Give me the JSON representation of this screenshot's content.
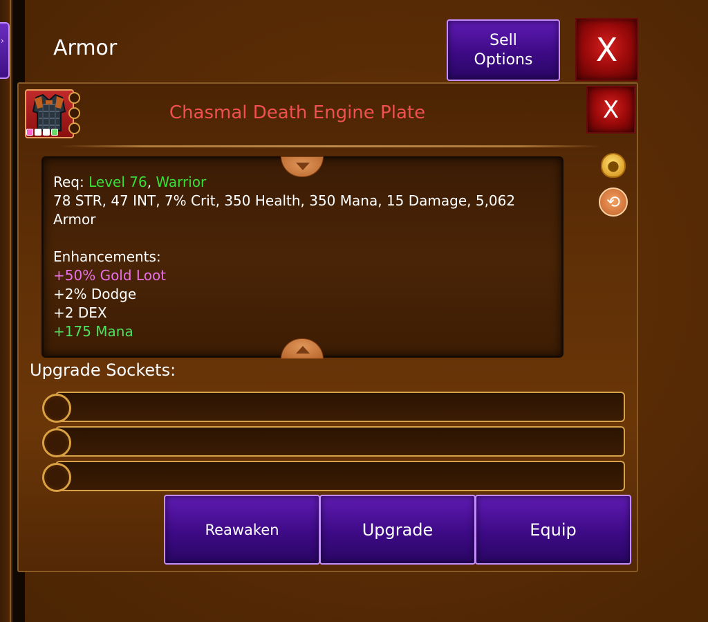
{
  "header": {
    "title": "Armor",
    "sell_button_label": "Sell Options",
    "close_label": "X"
  },
  "item": {
    "name": "Chasmal Death Engine Plate",
    "name_color": "#f05050",
    "close_label": "X",
    "rarity_pips": [
      "#ff66cc",
      "#ffffff",
      "#ffffff",
      "#66dd66"
    ],
    "requirements": {
      "prefix": "Req: ",
      "level": "Level 76",
      "separator": ", ",
      "class": "Warrior"
    },
    "stats_line1": "78 STR, 47 INT, 7% Crit, 350 Health, 350 Mana, 15 Damage, 5,062",
    "stats_line2": "Armor",
    "enhancements_title": "Enhancements:",
    "enhancements": [
      {
        "text": "+50% Gold Loot",
        "color": "#e870e8"
      },
      {
        "text": "+2% Dodge",
        "color": "#ffffff"
      },
      {
        "text": "+2 DEX",
        "color": "#ffffff"
      },
      {
        "text": "+175 Mana",
        "color": "#50e060"
      }
    ]
  },
  "sockets": {
    "title": "Upgrade Sockets:",
    "count": 3
  },
  "actions": {
    "reawaken": "Reawaken",
    "upgrade": "Upgrade",
    "equip": "Equip"
  },
  "icons": {
    "gold_bag": "gold-bag-icon",
    "swap": "swap-icon"
  }
}
